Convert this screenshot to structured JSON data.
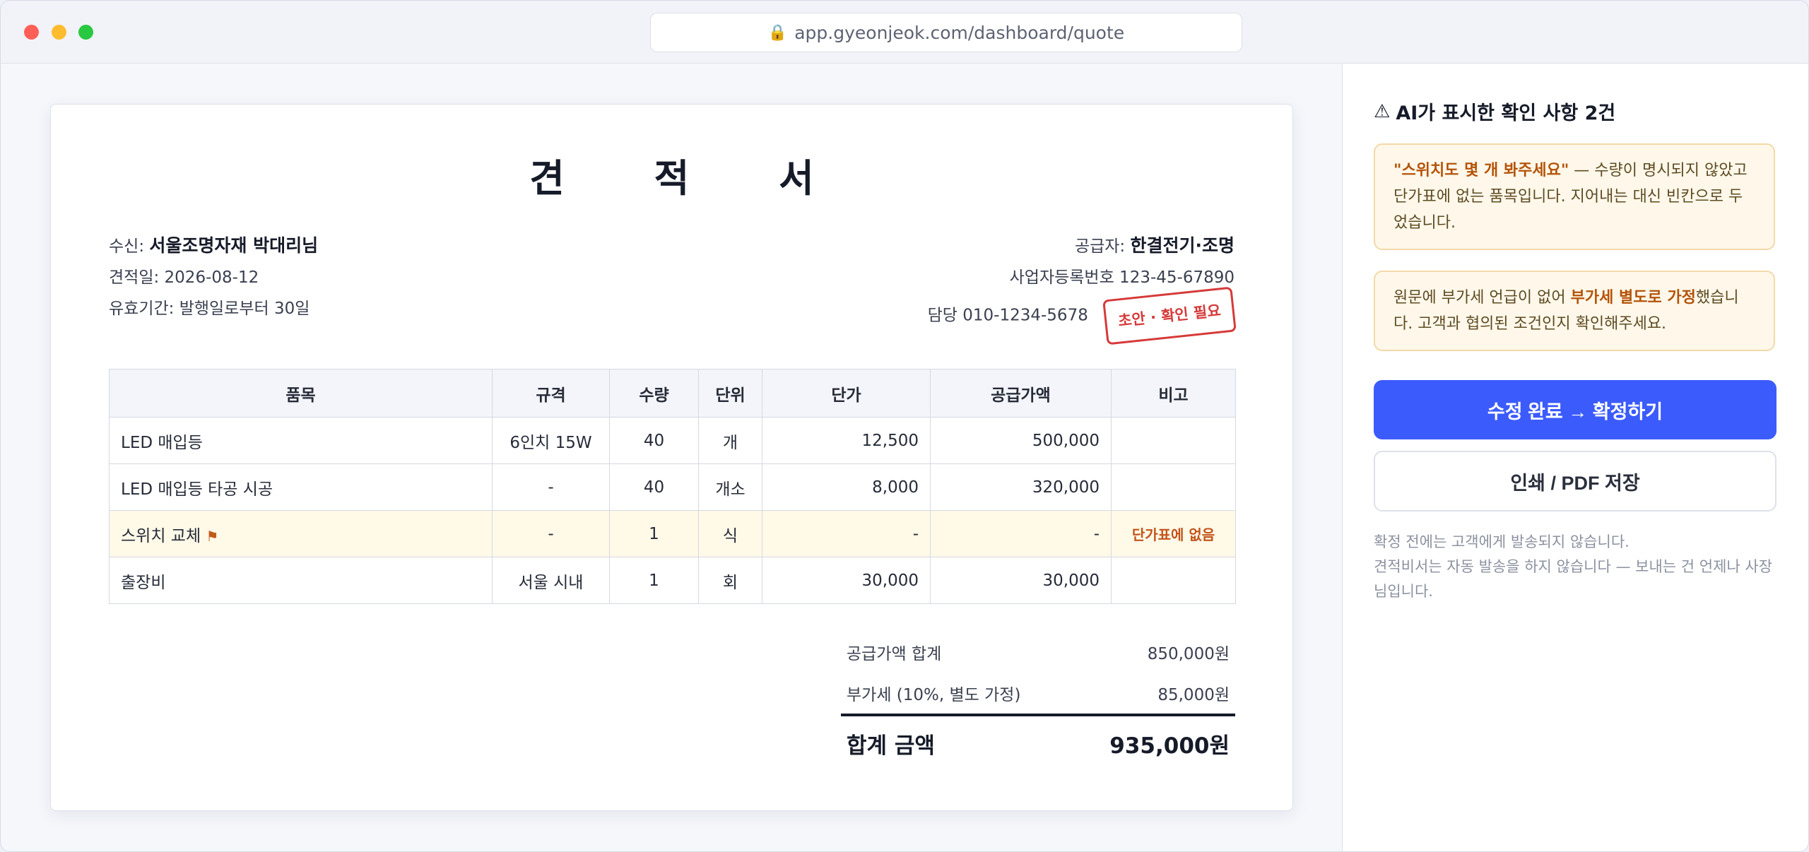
{
  "browser": {
    "url": "app.gyeonjeok.com/dashboard/quote"
  },
  "quote": {
    "title": "견 적 서",
    "recipient_label": "수신:",
    "recipient": "서울조명자재 박대리님",
    "date_line": "견적일: 2026-08-12",
    "validity_line": "유효기간: 발행일로부터 30일",
    "supplier_label": "공급자:",
    "supplier": "한결전기·조명",
    "business_no_line": "사업자등록번호 123-45-67890",
    "contact_line": "담당 010-1234-5678",
    "stamp": "초안 · 확인 필요",
    "columns": [
      "품목",
      "규격",
      "수량",
      "단위",
      "단가",
      "공급가액",
      "비고"
    ],
    "rows": [
      {
        "item": "LED 매입등",
        "spec": "6인치 15W",
        "qty": "40",
        "unit": "개",
        "price": "12,500",
        "amount": "500,000",
        "note": ""
      },
      {
        "item": "LED 매입등 타공 시공",
        "spec": "-",
        "qty": "40",
        "unit": "개소",
        "price": "8,000",
        "amount": "320,000",
        "note": ""
      },
      {
        "item": "스위치 교체",
        "spec": "-",
        "qty": "1",
        "unit": "식",
        "price": "-",
        "amount": "-",
        "note": "단가표에 없음"
      },
      {
        "item": "출장비",
        "spec": "서울 시내",
        "qty": "1",
        "unit": "회",
        "price": "30,000",
        "amount": "30,000",
        "note": ""
      }
    ],
    "flag_icon": "flag-icon",
    "subtotal_label": "공급가액 합계",
    "subtotal_value": "850,000원",
    "vat_label": "부가세 (10%, 별도 가정)",
    "vat_value": "85,000원",
    "total_label": "합계 금액",
    "total_value": "935,000원"
  },
  "sidebar": {
    "title": "AI가 표시한 확인 사항 2건",
    "warning_icon": "warning-icon",
    "card1_quote": "\"스위치도 몇 개 봐주세요\"",
    "card1_text": " — 수량이 명시되지 않았고 단가표에 없는 품목입니다. 지어내는 대신 빈칸으로 두었습니다.",
    "card2_text_before": "원문에 부가세 언급이 없어 ",
    "card2_em": "부가세 별도로 가정",
    "card2_text_after": "했습니다. 고객과 협의된 조건인지 확인해주세요.",
    "confirm_button": "수정 완료 → 확정하기",
    "print_button": "인쇄 / PDF 저장",
    "footnote_1": "확정 전에는 고객에게 발송되지 않습니다.",
    "footnote_2": "견적비서는 자동 발송을 하지 않습니다 — 보내는 건 언제나 사장님입니다."
  },
  "colors": {
    "primary": "#3b5bfd",
    "stamp": "#d63a3a",
    "warning": "#b45309",
    "flagged_row": "#fff9e8"
  }
}
